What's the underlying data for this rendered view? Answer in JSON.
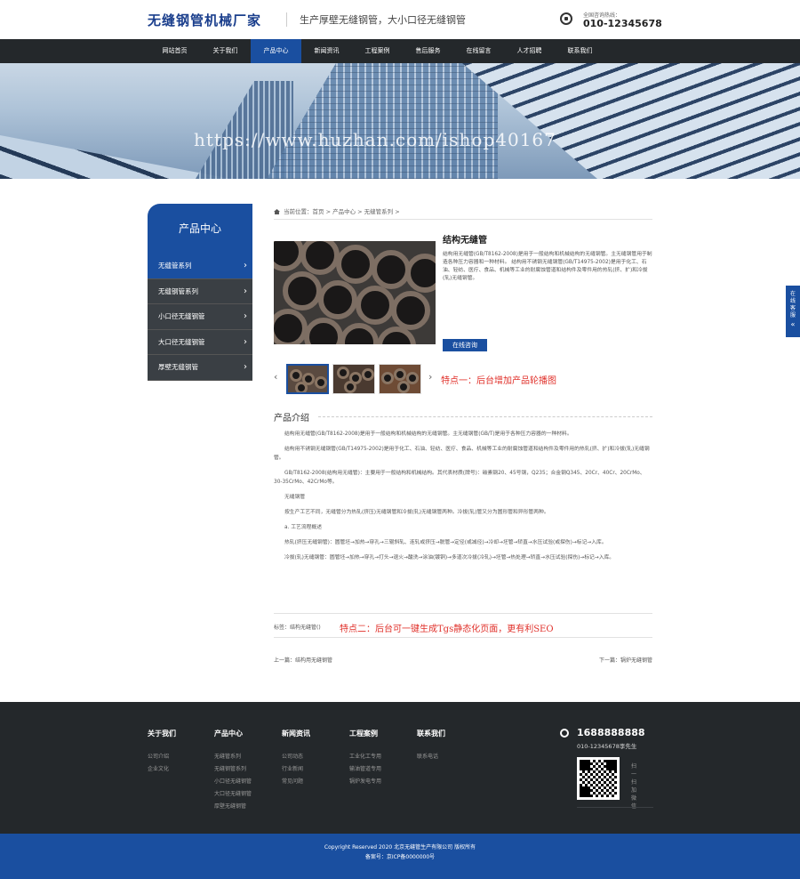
{
  "header": {
    "logo": "无缝钢管机械厂家",
    "slogan": "生产厚壁无缝钢管，大小口径无缝钢管",
    "hotline_label": "全国咨询热线：",
    "hotline_number": "010-12345678"
  },
  "nav": {
    "items": [
      "网站首页",
      "关于我们",
      "产品中心",
      "新闻资讯",
      "工程案例",
      "售后服务",
      "在线留言",
      "人才招聘",
      "联系我们"
    ],
    "active_index": 2
  },
  "banner": {
    "watermark": "https://www.huzhan.com/ishop40167"
  },
  "sidebar": {
    "title": "产品中心",
    "items": [
      {
        "label": "无缝管系列",
        "active": true
      },
      {
        "label": "无缝钢管系列",
        "active": false
      },
      {
        "label": "小口径无缝钢管",
        "active": false
      },
      {
        "label": "大口径无缝钢管",
        "active": false
      },
      {
        "label": "厚壁无缝钢管",
        "active": false
      }
    ]
  },
  "breadcrumb": "当前位置：首页 > 产品中心 > 无缝管系列 >",
  "product": {
    "title": "结构无缝管",
    "description": "结构用无缝管(GB/T8162-2008)是用于一般结构和机械结构的无缝钢管。主无缝钢管用于制造各种压力容器和一种材料。 结构用不锈钢无缝钢管(GB/T14975-2002)是用于化工、石油、轻纺、医疗、食品、机械等工业的耐腐蚀管道和结构件及零件用的热轧(挤、扩)和冷拔(轧)无缝钢管。",
    "consult_button": "在线咨询",
    "feature1": "特点一：后台增加产品轮播图"
  },
  "intro": {
    "heading": "产品介绍",
    "paragraphs": [
      "结构用无缝管(GB/T8162-2008)是用于一般结构和机械结构的无缝钢管。主无缝钢管(GB/T)是用于各种压力容器的一种材料。",
      "结构用不锈钢无缝钢管(GB/T14975-2002)是用于化工、石油、轻纺、医疗、食品、机械等工业的耐腐蚀管道和结构件及零件用的热轧(挤、扩)和冷拔(轧)无缝钢管。",
      "GB/T8162-2008(结构用无缝管)：主要用于一般结构和机械结构。其代表材质(牌号)：碳素钢20、45号钢，Q235；合金钢Q345、20Cr、40Cr、20CrMo、30-35CrMo、42CrMo等。",
      "无缝钢管",
      "按生产工艺不同，无缝管分为热轧(挤压)无缝钢管和冷拔(轧)无缝钢管两种。冷拔(轧)管又分为圆形管和异形管两种。",
      "a. 工艺流程概述",
      "热轧(挤压无缝钢管)：圆管坯→加热→穿孔→三辊斜轧、连轧或挤压→脱管→定径(或减径)→冷却→坯管→矫直→水压试验(或探伤)→标记→入库。",
      "冷拔(轧)无缝钢管：圆管坯→加热→穿孔→打头→退火→酸洗→涂油(镀铜)→多道次冷拔(冷轧)→坯管→热处理→矫直→水压试验(探伤)→标记→入库。"
    ]
  },
  "tags": {
    "label": "标签：结构无缝管()",
    "feature2": "特点二：后台可一键生成Tgs静态化页面，更有利SEO"
  },
  "pager": {
    "prev": "上一篇：结构用无缝钢管",
    "next": "下一篇：锅炉无缝钢管"
  },
  "float_online": "在线客服",
  "footer": {
    "columns": [
      {
        "title": "关于我们",
        "links": [
          "公司介绍",
          "企业文化"
        ]
      },
      {
        "title": "产品中心",
        "links": [
          "无缝管系列",
          "无缝钢管系列",
          "小口径无缝钢管",
          "大口径无缝钢管",
          "厚壁无缝钢管"
        ]
      },
      {
        "title": "新闻资讯",
        "links": [
          "公司动态",
          "行业新闻",
          "常见问题"
        ]
      },
      {
        "title": "工程案例",
        "links": [
          "工业化工专用",
          "输油管道专用",
          "锅炉发电专用"
        ]
      },
      {
        "title": "联系我们",
        "links": [
          "联系电话"
        ]
      }
    ],
    "phone": "1688888888",
    "phone2": "010-12345678李先生",
    "qr_label": "扫一扫加微信",
    "copyright": "Copyright Reserved 2020 北京无缝管生产有限公司 版权所有",
    "icp": "备案号：京ICP备0000000号"
  }
}
